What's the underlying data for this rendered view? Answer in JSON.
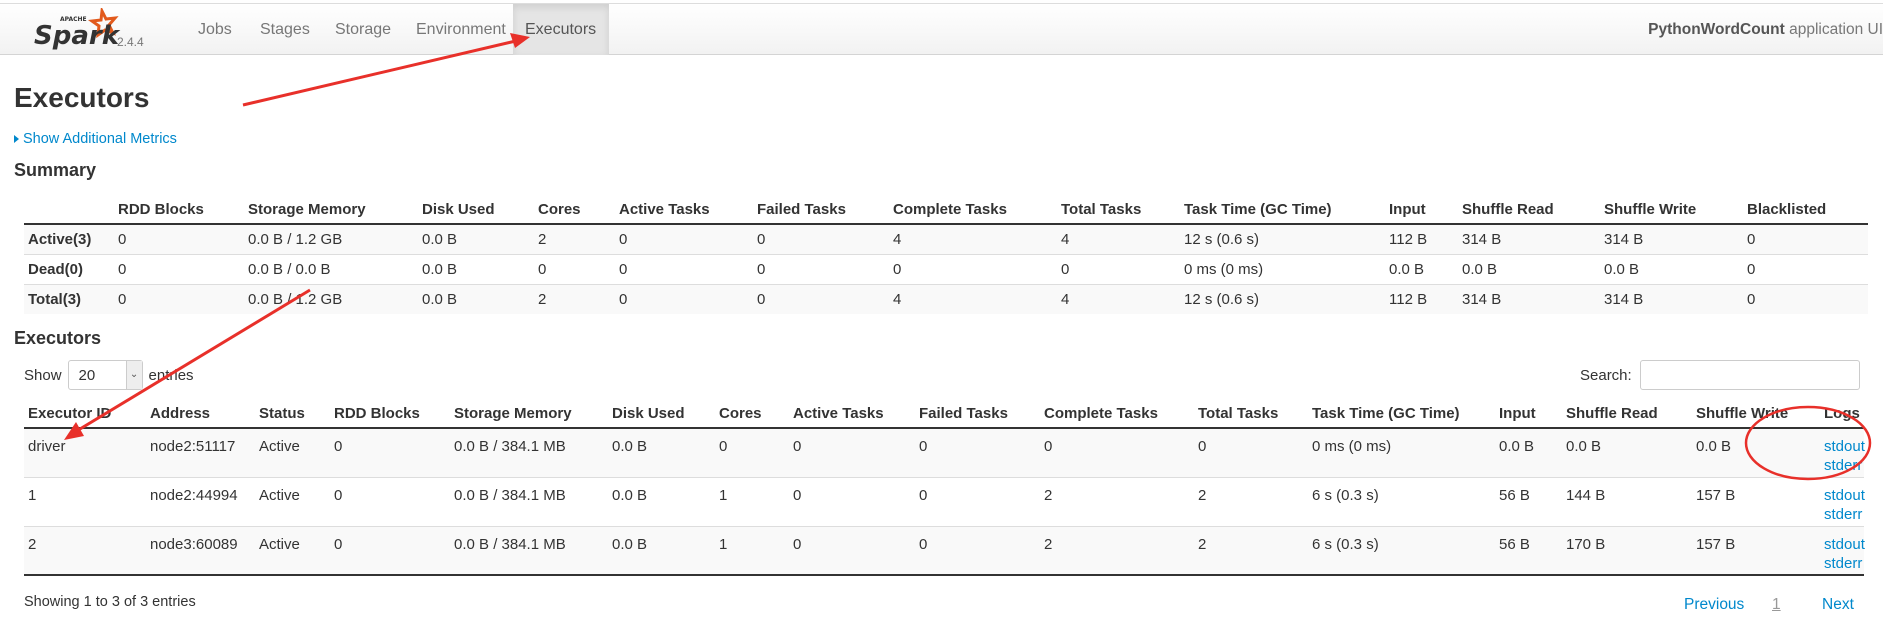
{
  "nav": {
    "logo_text": "Spark",
    "logo_sup": "APACHE",
    "version": "2.4.4",
    "tabs": [
      "Jobs",
      "Stages",
      "Storage",
      "Environment",
      "Executors"
    ],
    "active_tab": "Executors",
    "app_name": "PythonWordCount",
    "app_suffix": "application UI"
  },
  "page": {
    "title": "Executors",
    "show_metrics": "Show Additional Metrics",
    "summary_heading": "Summary",
    "executors_heading": "Executors"
  },
  "summary": {
    "headers": [
      "",
      "RDD Blocks",
      "Storage Memory",
      "Disk Used",
      "Cores",
      "Active Tasks",
      "Failed Tasks",
      "Complete Tasks",
      "Total Tasks",
      "Task Time (GC Time)",
      "Input",
      "Shuffle Read",
      "Shuffle Write",
      "Blacklisted"
    ],
    "rows": [
      [
        "Active(3)",
        "0",
        "0.0 B / 1.2 GB",
        "0.0 B",
        "2",
        "0",
        "0",
        "4",
        "4",
        "12 s (0.6 s)",
        "112 B",
        "314 B",
        "314 B",
        "0"
      ],
      [
        "Dead(0)",
        "0",
        "0.0 B / 0.0 B",
        "0.0 B",
        "0",
        "0",
        "0",
        "0",
        "0",
        "0 ms (0 ms)",
        "0.0 B",
        "0.0 B",
        "0.0 B",
        "0"
      ],
      [
        "Total(3)",
        "0",
        "0.0 B / 1.2 GB",
        "0.0 B",
        "2",
        "0",
        "0",
        "4",
        "4",
        "12 s (0.6 s)",
        "112 B",
        "314 B",
        "314 B",
        "0"
      ]
    ]
  },
  "controls": {
    "show_label": "Show",
    "page_size": "20",
    "entries_label": "entries",
    "search_label": "Search:",
    "search_value": ""
  },
  "executors": {
    "headers": [
      "Executor ID",
      "Address",
      "Status",
      "RDD Blocks",
      "Storage Memory",
      "Disk Used",
      "Cores",
      "Active Tasks",
      "Failed Tasks",
      "Complete Tasks",
      "Total Tasks",
      "Task Time (GC Time)",
      "Input",
      "Shuffle Read",
      "Shuffle Write",
      "Logs"
    ],
    "rows": [
      [
        "driver",
        "node2:51117",
        "Active",
        "0",
        "0.0 B / 384.1 MB",
        "0.0 B",
        "0",
        "0",
        "0",
        "0",
        "0",
        "0 ms (0 ms)",
        "0.0 B",
        "0.0 B",
        "0.0 B"
      ],
      [
        "1",
        "node2:44994",
        "Active",
        "0",
        "0.0 B / 384.1 MB",
        "0.0 B",
        "1",
        "0",
        "0",
        "2",
        "2",
        "6 s (0.3 s)",
        "56 B",
        "144 B",
        "157 B"
      ],
      [
        "2",
        "node3:60089",
        "Active",
        "0",
        "0.0 B / 384.1 MB",
        "0.0 B",
        "1",
        "0",
        "0",
        "2",
        "2",
        "6 s (0.3 s)",
        "56 B",
        "170 B",
        "157 B"
      ]
    ],
    "log_links": [
      "stdout",
      "stderr"
    ]
  },
  "footer": {
    "info": "Showing 1 to 3 of 3 entries",
    "previous": "Previous",
    "page": "1",
    "next": "Next"
  },
  "colors": {
    "link": "#0088cc",
    "spark_orange": "#e25a1c",
    "annotation": "#e8302a"
  }
}
